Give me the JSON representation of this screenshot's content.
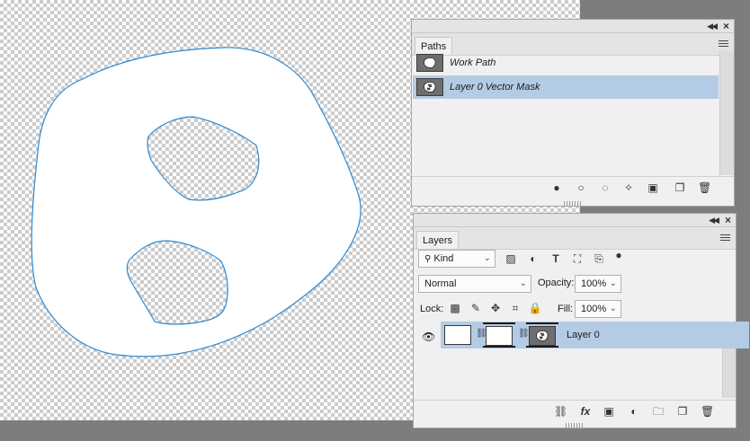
{
  "paths_panel": {
    "tab_label": "Paths",
    "items": [
      {
        "name": "Work Path",
        "selected": false
      },
      {
        "name": "Layer 0 Vector Mask",
        "selected": true
      }
    ],
    "bottom_icons": [
      "fill-path-icon",
      "stroke-path-icon",
      "load-selection-icon",
      "make-work-path-icon",
      "add-mask-icon",
      "new-path-icon",
      "delete-path-icon"
    ]
  },
  "layers_panel": {
    "tab_label": "Layers",
    "filter_kind": "Kind",
    "blend_mode": "Normal",
    "opacity_label": "Opacity:",
    "opacity_value": "100%",
    "lock_label": "Lock:",
    "fill_label": "Fill:",
    "fill_value": "100%",
    "layers": [
      {
        "name": "Layer 0",
        "visible": true,
        "selected": true
      }
    ]
  },
  "colors": {
    "selection": "#b4cbe5",
    "path_stroke": "#2d8ad3",
    "panel_bg": "#f0f0f0"
  }
}
